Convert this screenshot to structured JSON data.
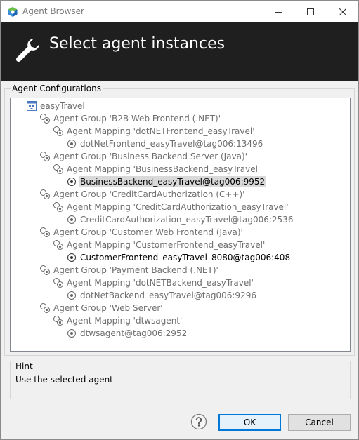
{
  "window": {
    "title": "Agent Browser"
  },
  "header": {
    "title": "Select agent instances"
  },
  "configurations": {
    "label": "Agent Configurations",
    "root": "easyTravel",
    "groups": [
      {
        "label": "Agent Group 'B2B Web Frontend (.NET)'",
        "mapping": "Agent Mapping 'dotNETFrontend_easyTravel'",
        "agent": "dotNetFrontend_easyTravel@tag006:13496"
      },
      {
        "label": "Agent Group 'Business Backend Server (Java)'",
        "mapping": "Agent Mapping 'BusinessBackend_easyTravel'",
        "agent": "BusinessBackend_easyTravel@tag006:9952"
      },
      {
        "label": "Agent Group 'CreditCardAuthorization (C++)'",
        "mapping": "Agent Mapping 'CreditCardAuthorization_easyTravel'",
        "agent": "CreditCardAuthorization_easyTravel@tag006:2536"
      },
      {
        "label": "Agent Group 'Customer Web Frontend (Java)'",
        "mapping": "Agent Mapping 'CustomerFrontend_easyTravel'",
        "agent": "CustomerFrontend_easyTravel_8080@tag006:408"
      },
      {
        "label": "Agent Group 'Payment Backend (.NET)'",
        "mapping": "Agent Mapping 'dotNETBackend_easyTravel'",
        "agent": "dotNetBackend_easyTravel@tag006:9296"
      },
      {
        "label": "Agent Group 'Web Server'",
        "mapping": "Agent Mapping 'dtwsagent'",
        "agent": "dtwsagent@tag006:2952"
      }
    ]
  },
  "hint": {
    "label": "Hint",
    "text": "Use the selected agent"
  },
  "buttons": {
    "ok": "OK",
    "cancel": "Cancel"
  }
}
